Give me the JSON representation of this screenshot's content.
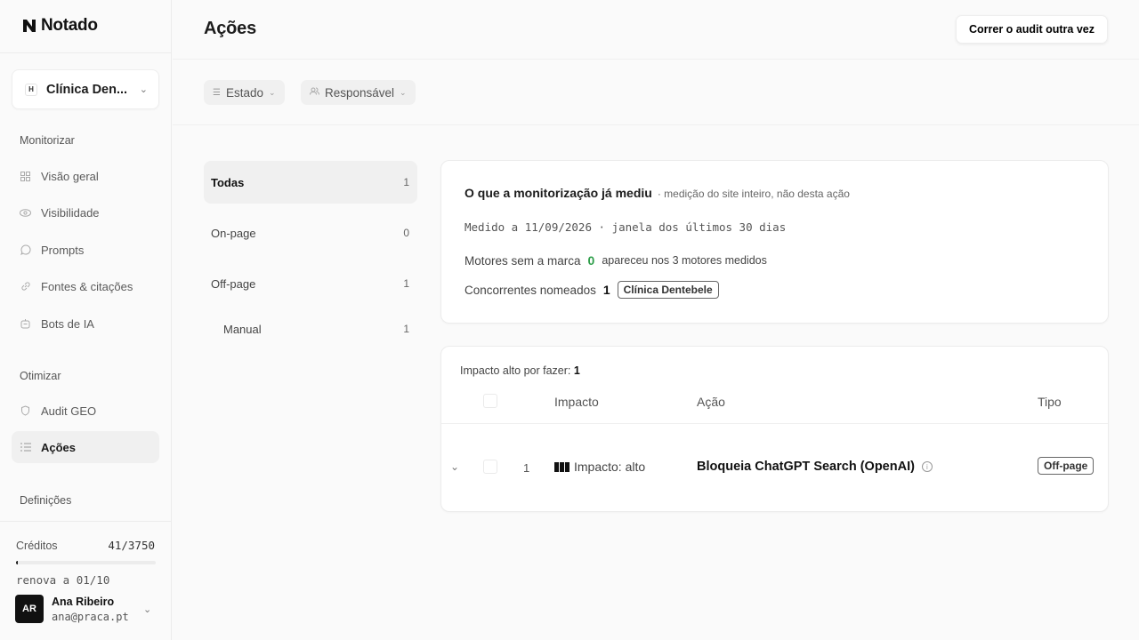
{
  "app": {
    "name": "Notado"
  },
  "workspace": {
    "initial": "H",
    "name": "Clínica Den..."
  },
  "sidebar": {
    "sections": {
      "monitor": "Monitorizar",
      "optimize": "Otimizar",
      "settings": "Definições"
    },
    "monitor_items": [
      {
        "label": "Visão geral",
        "icon": "grid-icon"
      },
      {
        "label": "Visibilidade",
        "icon": "eye-icon"
      },
      {
        "label": "Prompts",
        "icon": "chat-bubble-icon"
      },
      {
        "label": "Fontes & citações",
        "icon": "link-icon"
      },
      {
        "label": "Bots de IA",
        "icon": "bot-icon"
      }
    ],
    "optimize_items": [
      {
        "label": "Audit GEO",
        "icon": "shield-icon"
      },
      {
        "label": "Ações",
        "icon": "list-icon",
        "active": true
      }
    ]
  },
  "credits": {
    "label": "Créditos",
    "value": "41/3750",
    "used_fraction": 0.011,
    "renew": "renova a 01/10"
  },
  "user": {
    "initials": "AR",
    "name": "Ana Ribeiro",
    "email": "ana@praca.pt"
  },
  "header": {
    "title": "Ações",
    "run_button": "Correr o audit outra vez"
  },
  "filters": [
    {
      "label": "Estado"
    },
    {
      "label": "Responsável"
    }
  ],
  "categories": [
    {
      "label": "Todas",
      "count": "1",
      "active": true
    },
    {
      "label": "On-page",
      "count": "0"
    },
    {
      "label": "Off-page",
      "count": "1"
    },
    {
      "label": "Manual",
      "count": "1"
    }
  ],
  "monitoring": {
    "title": "O que a monitorização já mediu",
    "subtitle": "· medição do site inteiro, não desta ação",
    "measured": "Medido a 11/09/2026 · janela dos últimos 30 dias",
    "engines_label": "Motores sem a marca",
    "engines_value": "0",
    "engines_note": "apareceu nos 3 motores medidos",
    "competitors_label": "Concorrentes nomeados",
    "competitors_value": "1",
    "competitor_name": "Clínica Dentebele"
  },
  "actions_table": {
    "summary_label": "Impacto alto por fazer:",
    "summary_value": "1",
    "columns": {
      "impact": "Impacto",
      "action": "Ação",
      "type": "Tipo"
    },
    "rows": [
      {
        "num": "1",
        "impact": "Impacto: alto",
        "action": "Bloqueia ChatGPT Search (OpenAI)",
        "type": "Off-page"
      }
    ]
  },
  "colors": {
    "accent_green": "#2e9e4a",
    "dark": "#111111"
  }
}
